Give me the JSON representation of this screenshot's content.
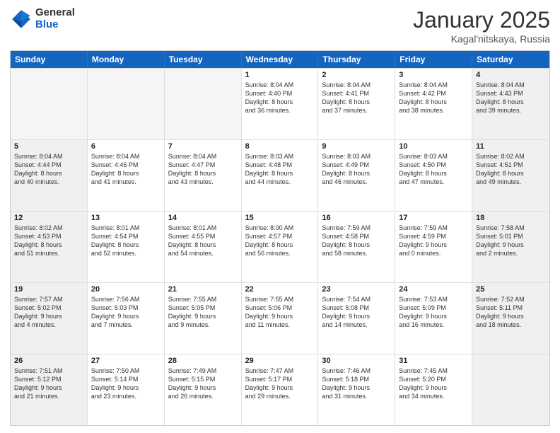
{
  "header": {
    "logo_general": "General",
    "logo_blue": "Blue",
    "month_title": "January 2025",
    "location": "Kagal'nitskaya, Russia"
  },
  "weekdays": [
    "Sunday",
    "Monday",
    "Tuesday",
    "Wednesday",
    "Thursday",
    "Friday",
    "Saturday"
  ],
  "rows": [
    [
      {
        "day": "",
        "text": "",
        "empty": true
      },
      {
        "day": "",
        "text": "",
        "empty": true
      },
      {
        "day": "",
        "text": "",
        "empty": true
      },
      {
        "day": "1",
        "text": "Sunrise: 8:04 AM\nSunset: 4:40 PM\nDaylight: 8 hours\nand 36 minutes."
      },
      {
        "day": "2",
        "text": "Sunrise: 8:04 AM\nSunset: 4:41 PM\nDaylight: 8 hours\nand 37 minutes."
      },
      {
        "day": "3",
        "text": "Sunrise: 8:04 AM\nSunset: 4:42 PM\nDaylight: 8 hours\nand 38 minutes."
      },
      {
        "day": "4",
        "text": "Sunrise: 8:04 AM\nSunset: 4:43 PM\nDaylight: 8 hours\nand 39 minutes.",
        "shaded": true
      }
    ],
    [
      {
        "day": "5",
        "text": "Sunrise: 8:04 AM\nSunset: 4:44 PM\nDaylight: 8 hours\nand 40 minutes.",
        "shaded": true
      },
      {
        "day": "6",
        "text": "Sunrise: 8:04 AM\nSunset: 4:46 PM\nDaylight: 8 hours\nand 41 minutes."
      },
      {
        "day": "7",
        "text": "Sunrise: 8:04 AM\nSunset: 4:47 PM\nDaylight: 8 hours\nand 43 minutes."
      },
      {
        "day": "8",
        "text": "Sunrise: 8:03 AM\nSunset: 4:48 PM\nDaylight: 8 hours\nand 44 minutes."
      },
      {
        "day": "9",
        "text": "Sunrise: 8:03 AM\nSunset: 4:49 PM\nDaylight: 8 hours\nand 46 minutes."
      },
      {
        "day": "10",
        "text": "Sunrise: 8:03 AM\nSunset: 4:50 PM\nDaylight: 8 hours\nand 47 minutes."
      },
      {
        "day": "11",
        "text": "Sunrise: 8:02 AM\nSunset: 4:51 PM\nDaylight: 8 hours\nand 49 minutes.",
        "shaded": true
      }
    ],
    [
      {
        "day": "12",
        "text": "Sunrise: 8:02 AM\nSunset: 4:53 PM\nDaylight: 8 hours\nand 51 minutes.",
        "shaded": true
      },
      {
        "day": "13",
        "text": "Sunrise: 8:01 AM\nSunset: 4:54 PM\nDaylight: 8 hours\nand 52 minutes."
      },
      {
        "day": "14",
        "text": "Sunrise: 8:01 AM\nSunset: 4:55 PM\nDaylight: 8 hours\nand 54 minutes."
      },
      {
        "day": "15",
        "text": "Sunrise: 8:00 AM\nSunset: 4:57 PM\nDaylight: 8 hours\nand 56 minutes."
      },
      {
        "day": "16",
        "text": "Sunrise: 7:59 AM\nSunset: 4:58 PM\nDaylight: 8 hours\nand 58 minutes."
      },
      {
        "day": "17",
        "text": "Sunrise: 7:59 AM\nSunset: 4:59 PM\nDaylight: 9 hours\nand 0 minutes."
      },
      {
        "day": "18",
        "text": "Sunrise: 7:58 AM\nSunset: 5:01 PM\nDaylight: 9 hours\nand 2 minutes.",
        "shaded": true
      }
    ],
    [
      {
        "day": "19",
        "text": "Sunrise: 7:57 AM\nSunset: 5:02 PM\nDaylight: 9 hours\nand 4 minutes.",
        "shaded": true
      },
      {
        "day": "20",
        "text": "Sunrise: 7:56 AM\nSunset: 5:03 PM\nDaylight: 9 hours\nand 7 minutes."
      },
      {
        "day": "21",
        "text": "Sunrise: 7:55 AM\nSunset: 5:05 PM\nDaylight: 9 hours\nand 9 minutes."
      },
      {
        "day": "22",
        "text": "Sunrise: 7:55 AM\nSunset: 5:06 PM\nDaylight: 9 hours\nand 11 minutes."
      },
      {
        "day": "23",
        "text": "Sunrise: 7:54 AM\nSunset: 5:08 PM\nDaylight: 9 hours\nand 14 minutes."
      },
      {
        "day": "24",
        "text": "Sunrise: 7:53 AM\nSunset: 5:09 PM\nDaylight: 9 hours\nand 16 minutes."
      },
      {
        "day": "25",
        "text": "Sunrise: 7:52 AM\nSunset: 5:11 PM\nDaylight: 9 hours\nand 18 minutes.",
        "shaded": true
      }
    ],
    [
      {
        "day": "26",
        "text": "Sunrise: 7:51 AM\nSunset: 5:12 PM\nDaylight: 9 hours\nand 21 minutes.",
        "shaded": true
      },
      {
        "day": "27",
        "text": "Sunrise: 7:50 AM\nSunset: 5:14 PM\nDaylight: 9 hours\nand 23 minutes."
      },
      {
        "day": "28",
        "text": "Sunrise: 7:49 AM\nSunset: 5:15 PM\nDaylight: 9 hours\nand 26 minutes."
      },
      {
        "day": "29",
        "text": "Sunrise: 7:47 AM\nSunset: 5:17 PM\nDaylight: 9 hours\nand 29 minutes."
      },
      {
        "day": "30",
        "text": "Sunrise: 7:46 AM\nSunset: 5:18 PM\nDaylight: 9 hours\nand 31 minutes."
      },
      {
        "day": "31",
        "text": "Sunrise: 7:45 AM\nSunset: 5:20 PM\nDaylight: 9 hours\nand 34 minutes."
      },
      {
        "day": "",
        "text": "",
        "empty": true,
        "shaded": true
      }
    ]
  ]
}
